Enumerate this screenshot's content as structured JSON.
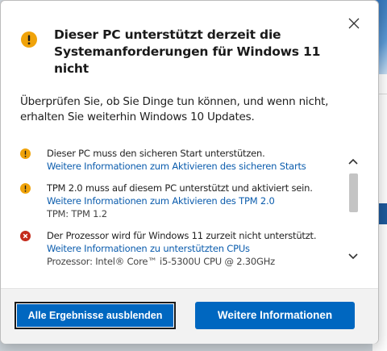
{
  "dialog": {
    "title": "Dieser PC unterstützt derzeit die Systemanforderungen für Windows 11 nicht",
    "description": "Überprüfen Sie, ob Sie Dinge tun können, und wenn nicht, erhalten Sie weiterhin Windows 10 Updates.",
    "close_icon": "close-icon",
    "title_icon": "warning-icon"
  },
  "issues": [
    {
      "severity": "warning",
      "icon": "warning-icon",
      "text": "Dieser PC muss den sicheren Start unterstützen.",
      "link": "Weitere Informationen zum Aktivieren des sicheren Starts",
      "detail": ""
    },
    {
      "severity": "warning",
      "icon": "warning-icon",
      "text": "TPM 2.0 muss auf diesem PC unterstützt und aktiviert sein.",
      "link": "Weitere Informationen zum Aktivieren des TPM 2.0",
      "detail": "TPM: TPM 1.2"
    },
    {
      "severity": "error",
      "icon": "error-icon",
      "text": "Der Prozessor wird für Windows 11 zurzeit nicht unterstützt.",
      "link": "Weitere Informationen zu unterstützten CPUs",
      "detail": "Prozessor: Intel® Core™ i5-5300U CPU @ 2.30GHz"
    }
  ],
  "buttons": {
    "hide_results": "Alle Ergebnisse ausblenden",
    "more_info": "Weitere Informationen"
  },
  "colors": {
    "warning": "#f0a30a",
    "error": "#c42b1c",
    "link": "#0b5cad",
    "accent": "#0067c0"
  }
}
